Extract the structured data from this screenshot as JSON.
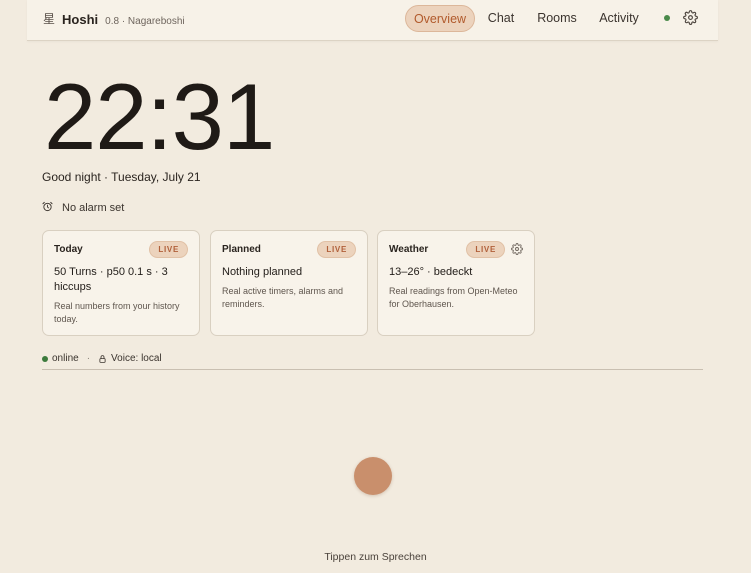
{
  "header": {
    "glyph": "星",
    "app_name": "Hoshi",
    "version": "0.8 · Nagareboshi",
    "tabs": [
      {
        "label": "Overview",
        "active": true
      },
      {
        "label": "Chat",
        "active": false
      },
      {
        "label": "Rooms",
        "active": false
      },
      {
        "label": "Activity",
        "active": false
      }
    ],
    "status_color": "#4a8a4a",
    "settings_icon": "gear-icon"
  },
  "clock": {
    "time": "22:31",
    "greeting": "Good night · Tuesday, July 21"
  },
  "alarm": {
    "icon": "alarm-clock-icon",
    "text": "No alarm set"
  },
  "cards": [
    {
      "title": "Today",
      "badge": "LIVE",
      "main": "50 Turns · p50 0.1 s · 3 hiccups",
      "sub": "Real numbers from your history today.",
      "has_settings": false
    },
    {
      "title": "Planned",
      "badge": "LIVE",
      "main": "Nothing planned",
      "sub": "Real active timers, alarms and reminders.",
      "has_settings": false
    },
    {
      "title": "Weather",
      "badge": "LIVE",
      "main": "13–26° · bedeckt",
      "sub": "Real readings from Open-Meteo for Oberhausen.",
      "has_settings": true
    }
  ],
  "connection": {
    "status": "online",
    "separator": "·",
    "voice": "Voice: local",
    "status_color": "#3c7a3c"
  },
  "voice": {
    "hint": "Tippen zum Sprechen",
    "button_color": "#c98f6c"
  },
  "colors": {
    "background": "#f2ebdf",
    "accent": "#b15a2c",
    "accent_bg": "#ecd3bd"
  }
}
